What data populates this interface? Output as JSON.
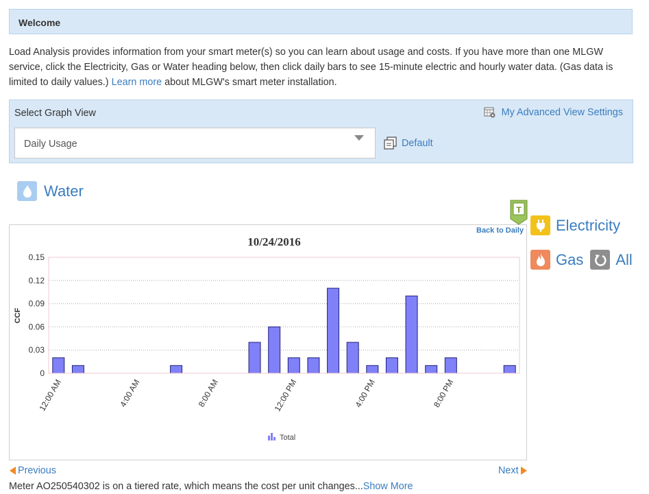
{
  "welcome": {
    "title": "Welcome"
  },
  "intro": {
    "text_before": "Load Analysis provides information from your smart meter(s) so you can learn about usage and costs. If you have more than one MLGW service, click the Electricity, Gas or Water heading below, then click daily bars to see 15-minute electric and hourly water data. (Gas data is limited to daily values.) ",
    "link": "Learn more",
    "text_after": " about MLGW's smart meter installation."
  },
  "graph_view": {
    "label": "Select Graph View",
    "advanced_link": "My Advanced View Settings",
    "selected": "Daily Usage",
    "default_link": "Default"
  },
  "service": {
    "water": "Water",
    "electricity": "Electricity",
    "gas": "Gas",
    "all": "All"
  },
  "back_to_daily": "Back to Daily",
  "colors": {
    "bar": "#8080f8",
    "bar_stroke": "#22227a",
    "link": "#3a7dbf",
    "accent": "#f08a24"
  },
  "chart_data": {
    "type": "bar",
    "title": "10/24/2016",
    "ylabel": "CCF",
    "xlabel": "",
    "ylim": [
      0,
      0.15
    ],
    "yticks": [
      "0",
      "0.03",
      "0.06",
      "0.09",
      "0.12",
      "0.15"
    ],
    "x_tick_labels": [
      "12:00 AM",
      "4:00 AM",
      "8:00 AM",
      "12:00 PM",
      "4:00 PM",
      "8:00 PM"
    ],
    "series": [
      {
        "name": "Total",
        "values": [
          0.02,
          0.01,
          0,
          0,
          0,
          0,
          0.01,
          0,
          0,
          0,
          0.04,
          0.06,
          0.02,
          0.02,
          0.11,
          0.04,
          0.01,
          0.02,
          0.1,
          0.01,
          0.02,
          0,
          0,
          0.01
        ]
      }
    ],
    "grid": true,
    "legend": "bottom-center"
  },
  "nav": {
    "previous": "Previous",
    "next": "Next"
  },
  "meter": {
    "text": "Meter AO250540302 is on a tiered rate, which means the cost per unit changes...",
    "show_more": "Show More"
  }
}
